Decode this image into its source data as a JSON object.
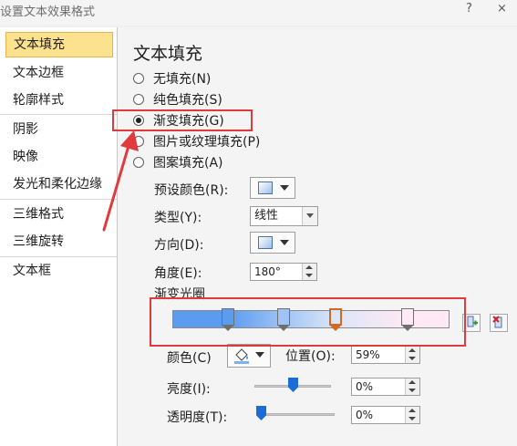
{
  "window": {
    "title": "设置文本效果格式",
    "help_label": "?",
    "close_label": "×"
  },
  "sidebar": {
    "items": [
      {
        "label": "文本填充",
        "active": true
      },
      {
        "label": "文本边框"
      },
      {
        "label": "轮廓样式"
      },
      {
        "label": "阴影"
      },
      {
        "label": "映像"
      },
      {
        "label": "发光和柔化边缘"
      },
      {
        "label": "三维格式"
      },
      {
        "label": "三维旋转"
      },
      {
        "label": "文本框"
      }
    ]
  },
  "panel": {
    "heading": "文本填充",
    "fill_options": [
      {
        "label": "无填充(N)",
        "selected": false
      },
      {
        "label": "纯色填充(S)",
        "selected": false
      },
      {
        "label": "渐变填充(G)",
        "selected": true
      },
      {
        "label": "图片或纹理填充(P)",
        "selected": false
      },
      {
        "label": "图案填充(A)",
        "selected": false
      }
    ],
    "preset_colors_label": "预设颜色(R):",
    "type_label": "类型(Y):",
    "type_value": "线性",
    "direction_label": "方向(D):",
    "angle_label": "角度(E):",
    "angle_value": "180°",
    "gradient_stops_label": "渐变光圈",
    "gradient_colors": [
      "#5b9bf0",
      "#9fc3f5",
      "#dce6f7",
      "#ffe9f4"
    ],
    "gradient_stop_positions_percent": [
      20,
      40,
      59,
      85
    ],
    "selected_stop_index": 2,
    "color_label": "颜色(C)",
    "position_label": "位置(O):",
    "position_value": "59%",
    "brightness_label": "亮度(I):",
    "brightness_value": "0%",
    "brightness_level": 0.5,
    "transparency_label": "透明度(T):",
    "transparency_value": "0%",
    "transparency_level": 0.0
  },
  "colors": {
    "annotation_red": "#e0393e",
    "active_item_bg": "#fce28f",
    "slider_thumb": "#1c6cd6"
  },
  "icons": [
    "add-stop-icon",
    "remove-stop-icon",
    "paint-bucket-icon"
  ]
}
